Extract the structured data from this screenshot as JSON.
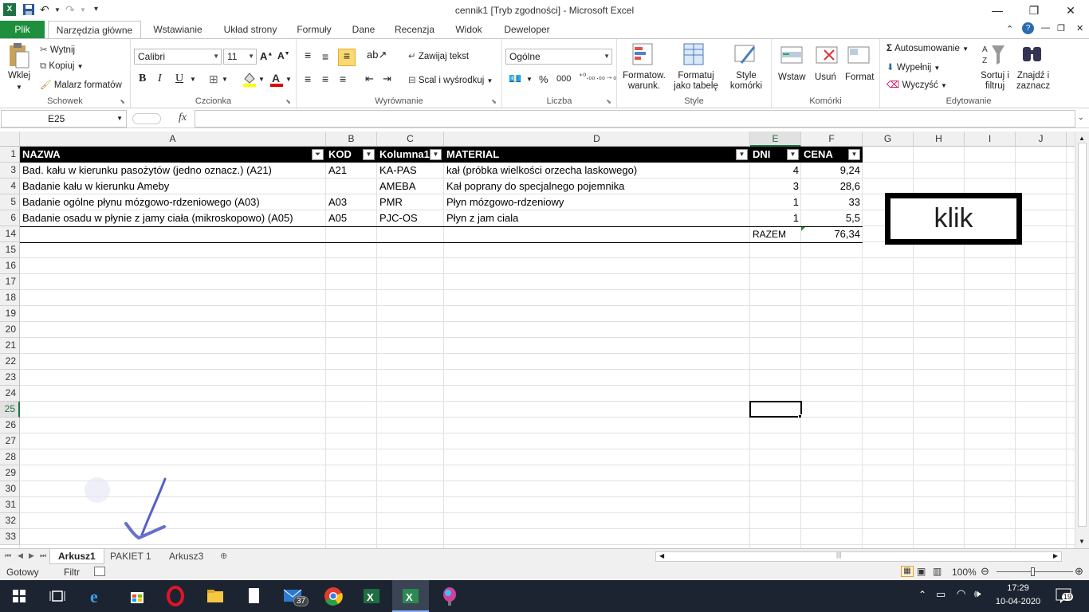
{
  "window": {
    "title": "cennik1  [Tryb zgodności]  -  Microsoft Excel",
    "minimize": "—",
    "restore": "❐",
    "close": "✕"
  },
  "tabs": [
    "Plik",
    "Narzędzia główne",
    "Wstawianie",
    "Układ strony",
    "Formuły",
    "Dane",
    "Recenzja",
    "Widok",
    "Deweloper"
  ],
  "ribbon": {
    "clipboard": {
      "paste": "Wklej",
      "cut": "Wytnij",
      "copy": "Kopiuj",
      "format_painter": "Malarz formatów",
      "label": "Schowek"
    },
    "font": {
      "name": "Calibri",
      "size": "11",
      "label": "Czcionka",
      "bold": "B",
      "italic": "I",
      "underline": "U"
    },
    "alignment": {
      "wrap": "Zawijaj tekst",
      "merge": "Scal i wyśrodkuj",
      "label": "Wyrównanie"
    },
    "number": {
      "format": "Ogólne",
      "percent": "%",
      "thousands": "000",
      "label": "Liczba"
    },
    "styles": {
      "conditional": "Formatow.\nwarunk.",
      "as_table": "Formatuj\njako tabelę",
      "cell_styles": "Style\nkomórki",
      "label": "Style"
    },
    "cells": {
      "insert": "Wstaw",
      "delete": "Usuń",
      "format": "Format",
      "label": "Komórki"
    },
    "editing": {
      "autosum": "Autosumowanie",
      "fill": "Wypełnij",
      "clear": "Wyczyść",
      "sort": "Sortuj i\nfiltruj",
      "find": "Znajdź i\nzaznacz",
      "label": "Edytowanie"
    }
  },
  "formula_bar": {
    "name_box": "E25",
    "fx": "fx",
    "value": ""
  },
  "columns": [
    "A",
    "B",
    "C",
    "D",
    "E",
    "F",
    "G",
    "H",
    "I",
    "J"
  ],
  "header_row": {
    "num": "1",
    "cells": [
      "NAZWA",
      "KOD",
      "Kolumna1",
      "MATERIAL",
      "DNI",
      "CENA"
    ]
  },
  "rows": [
    {
      "num": "3",
      "cells": [
        "Bad. kału w kierunku pasożytów (jedno oznacz.) (A21)",
        "A21",
        "KA-PAS",
        "kał (próbka wielkości orzecha laskowego)",
        "4",
        "9,24"
      ]
    },
    {
      "num": "4",
      "cells": [
        "Badanie kału w kierunku Ameby",
        "",
        "AMEBA",
        "Kał poprany do specjalnego pojemnika",
        "3",
        "28,6"
      ]
    },
    {
      "num": "5",
      "cells": [
        "Badanie ogólne płynu mózgowo-rdzeniowego (A03)",
        "A03",
        "PMR",
        "Płyn mózgowo-rdzeniowy",
        "1",
        "33"
      ]
    },
    {
      "num": "6",
      "cells": [
        "Badanie osadu w płynie z jamy ciała (mikroskopowo) (A05)",
        "A05",
        "PJC-OS",
        "Płyn z jam ciala",
        "1",
        "5,5"
      ]
    },
    {
      "num": "14",
      "cells": [
        "",
        "",
        "",
        "",
        "RAZEM",
        "76,34"
      ]
    }
  ],
  "empty_rows": [
    "15",
    "16",
    "17",
    "18",
    "19",
    "20",
    "21",
    "22",
    "23",
    "24",
    "25",
    "26",
    "27",
    "28",
    "29",
    "30",
    "31",
    "32",
    "33"
  ],
  "klik_button": "klik",
  "sheet_tabs": [
    "Arkusz1",
    "PAKIET 1",
    "Arkusz3"
  ],
  "status": {
    "ready": "Gotowy",
    "filter": "Filtr",
    "zoom": "100%"
  },
  "taskbar": {
    "time": "17:29",
    "date": "10-04-2020",
    "mail_badge": "37",
    "notif_badge": "19"
  }
}
